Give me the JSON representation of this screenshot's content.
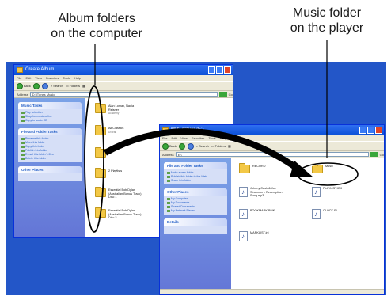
{
  "callouts": {
    "left": {
      "line1": "Album folders",
      "line2": "on the computer"
    },
    "right": {
      "line1": "Music folder",
      "line2": "on the player"
    }
  },
  "computer_window": {
    "title": "Create Album",
    "menu": [
      "File",
      "Edit",
      "View",
      "Favorites",
      "Tools",
      "Help"
    ],
    "toolbar": {
      "back": "Back",
      "search": "Search",
      "folders": "Folders"
    },
    "address_label": "Address",
    "address": "D:\\iTunes Music",
    "go": "Go",
    "task_panels": [
      {
        "title": "Music Tasks",
        "links": [
          "Play selection",
          "Shop for music online",
          "Copy to audio CD"
        ]
      },
      {
        "title": "File and Folder Tasks",
        "links": [
          "Rename this folder",
          "Move this folder",
          "Copy this folder",
          "Publish this folder",
          "E-mail this folder's files",
          "Delete this folder"
        ]
      },
      {
        "title": "Other Places",
        "links": []
      }
    ],
    "items": [
      {
        "name": "Alan Lomax, Nadia Reisner",
        "sub": "Academy"
      },
      {
        "name": "All Classics",
        "sub": "Dvořák"
      },
      {
        "name": "",
        "sub": ""
      },
      {
        "name": "2 Playlists",
        "sub": ""
      },
      {
        "name": "Essential Bob Dylan (Australian Bonus Track) Disc 1",
        "sub": ""
      },
      {
        "name": "Essential Bob Dylan (Australian Bonus Track) Disc 2",
        "sub": ""
      }
    ]
  },
  "player_window": {
    "title": "MP3 player (E:)",
    "menu": [
      "File",
      "Edit",
      "View",
      "Favorites",
      "Tools",
      "Help"
    ],
    "toolbar": {
      "back": "Back",
      "search": "Search",
      "folders": "Folders"
    },
    "address_label": "Address",
    "address": "E:\\",
    "go": "Go",
    "task_panels": [
      {
        "title": "File and Folder Tasks",
        "links": [
          "Make a new folder",
          "Publish this folder to the Web",
          "Share this folder"
        ]
      },
      {
        "title": "Other Places",
        "links": [
          "My Computer",
          "My Documents",
          "Shared Documents",
          "My Network Places"
        ]
      },
      {
        "title": "Details",
        "links": []
      }
    ],
    "items": [
      {
        "name": "RECORD",
        "sub": "",
        "type": "folder"
      },
      {
        "name": "Music",
        "sub": "",
        "type": "folder"
      },
      {
        "name": "Johnny Cash & Joe Strummer - Redemption Song.mp3",
        "sub": "",
        "type": "file"
      },
      {
        "name": "PLAYLIST.IBK",
        "sub": "",
        "type": "file"
      },
      {
        "name": "BOOKMARK.BMK",
        "sub": "",
        "type": "file"
      },
      {
        "name": "CLOCK.PL",
        "sub": "",
        "type": "file"
      },
      {
        "name": "MARKLIST.ini",
        "sub": "",
        "type": "file"
      }
    ]
  },
  "colors": {
    "desktop": "#2356c8",
    "titlebar": "#0a4fd6",
    "folder": "#f3c846",
    "arrow": "#000000"
  }
}
